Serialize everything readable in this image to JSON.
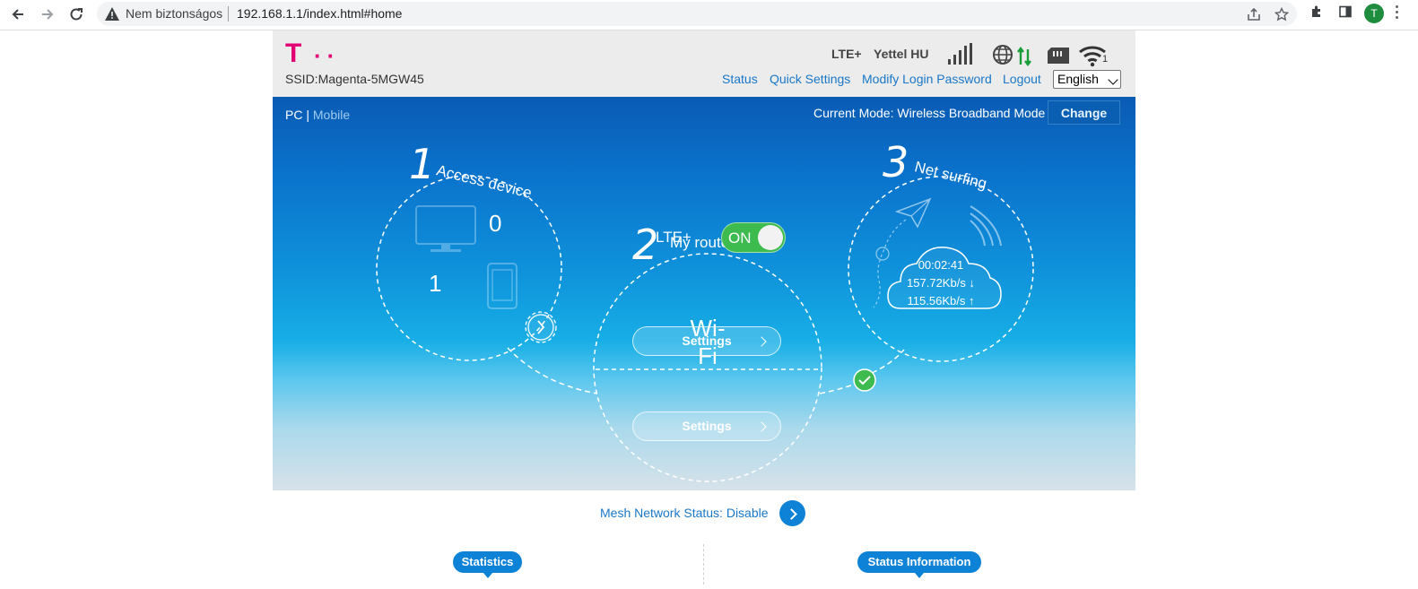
{
  "browser": {
    "security_label": "Nem biztonságos",
    "url": "192.168.1.1/index.html#home",
    "avatar_letter": "T",
    "icons": [
      "back-icon",
      "forward-icon",
      "reload-icon",
      "warning-icon",
      "share-icon",
      "star-icon",
      "extensions-icon",
      "side-panel-icon",
      "menu-icon"
    ]
  },
  "header": {
    "logo": "T",
    "ssid": "SSID:Magenta-5MGW45",
    "network_type": "LTE+",
    "carrier": "Yettel HU",
    "wifi_clients": "1",
    "nav": [
      "Status",
      "Quick Settings",
      "Modify Login Password",
      "Logout"
    ],
    "language": "English",
    "brand_color": "#e20074"
  },
  "stage": {
    "view_pc": "PC",
    "view_separator": "|",
    "view_mobile": "Mobile",
    "current_mode": "Current Mode: Wireless Broadband Mode",
    "change_label": "Change"
  },
  "access": {
    "step": "1",
    "title": "Access device",
    "wired_count": "0",
    "wireless_count": "1"
  },
  "router": {
    "step": "2",
    "title": "My router",
    "lte_label": "LTE+",
    "toggle_label": "ON",
    "lte_settings_label": "Settings",
    "wifi_label": "Wi-Fi",
    "wifi_settings_label": "Settings"
  },
  "surfing": {
    "step": "3",
    "title": "Net surfing",
    "duration": "00:02:41",
    "download": "157.72Kb/s ↓",
    "upload": "115.56Kb/s ↑"
  },
  "mesh": {
    "status_text": "Mesh Network Status: Disable"
  },
  "tabs": {
    "statistics": "Statistics",
    "status_information": "Status Information"
  }
}
